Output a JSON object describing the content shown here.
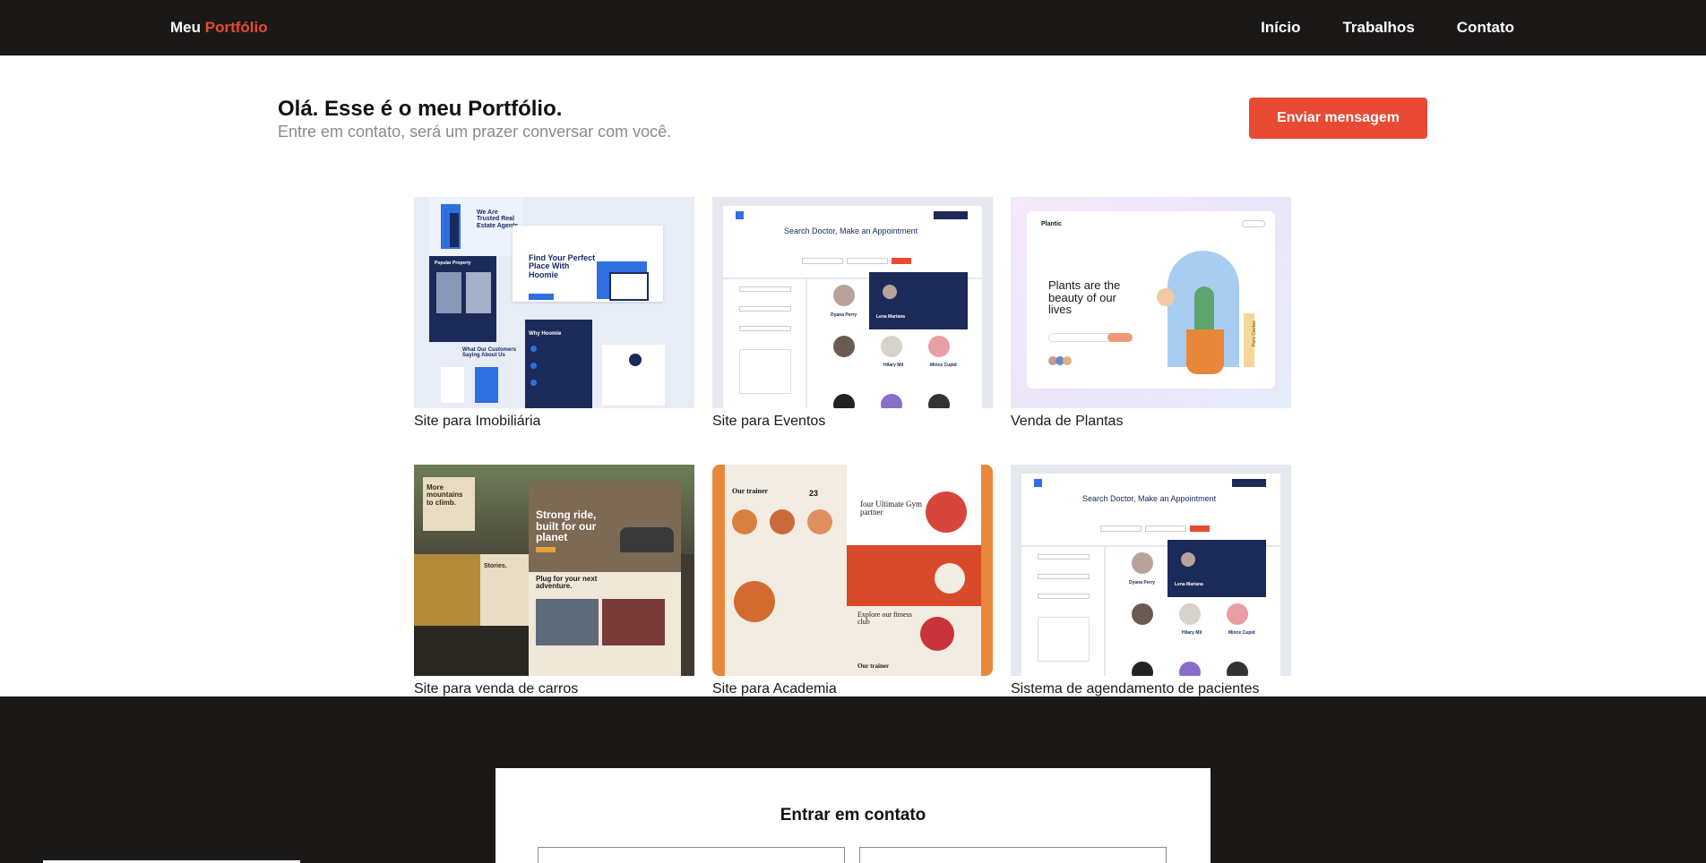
{
  "header": {
    "brand_prefix": "Meu",
    "brand_accent": "Portfólio",
    "nav": [
      "Início",
      "Trabalhos",
      "Contato"
    ]
  },
  "hero": {
    "title": "Olá. Esse é o meu Portfólio.",
    "subtitle": "Entre em contato, será um prazer conversar com você.",
    "button": "Enviar mensagem"
  },
  "projects": [
    {
      "label": "Site para Imobiliária",
      "thumb_text": [
        "We Are Trusted Real Estate Agents",
        "Find Your Perfect Place With Hoomie",
        "Why Hoomie",
        "What Our Customers Saying About Us",
        "Popular Property"
      ]
    },
    {
      "label": "Site para Eventos",
      "thumb_text": [
        "Search Doctor, Make an Appointment",
        "Lena Mariana",
        "Hilary Mil",
        "Mince Cupid",
        "Dyana Perry"
      ]
    },
    {
      "label": "Venda de Plantas",
      "thumb_text": [
        "Plantic",
        "Plants are the beauty of our lives",
        "Pure Cactus"
      ]
    },
    {
      "label": "Site para venda de carros",
      "thumb_text": [
        "More mountains to climb.",
        "Strong ride, built for our planet",
        "Plug for your next adventure.",
        "Stories."
      ]
    },
    {
      "label": "Site para Academia",
      "thumb_text": [
        "Our trainer",
        "23",
        "four Ultimate Gym partner",
        "Explore our fitness club",
        "Our trainer"
      ]
    },
    {
      "label": "Sistema de agendamento de pacientes",
      "thumb_text": [
        "Search Doctor, Make an Appointment",
        "Lena Mariana",
        "Hilary Mil",
        "Mince Cupid",
        "Dyana Perry"
      ]
    }
  ],
  "contact": {
    "title": "Entrar em contato"
  },
  "colors": {
    "accent": "#e84a33",
    "dark": "#1b1918",
    "white": "#ffffff"
  }
}
